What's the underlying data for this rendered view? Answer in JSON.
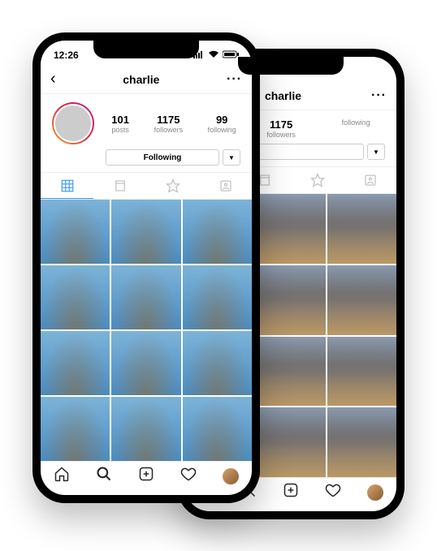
{
  "status": {
    "time": "12:26"
  },
  "header": {
    "username": "charlie"
  },
  "stats": {
    "posts": {
      "count": "101",
      "label": "posts"
    },
    "followers": {
      "count": "1175",
      "label": "followers"
    },
    "following": {
      "count": "99",
      "label": "following"
    }
  },
  "actions": {
    "follow_label": "Following"
  },
  "back_phone": {
    "username": "charlie",
    "followers": {
      "count": "1175",
      "label": "followers"
    },
    "following": {
      "count": "following"
    }
  }
}
